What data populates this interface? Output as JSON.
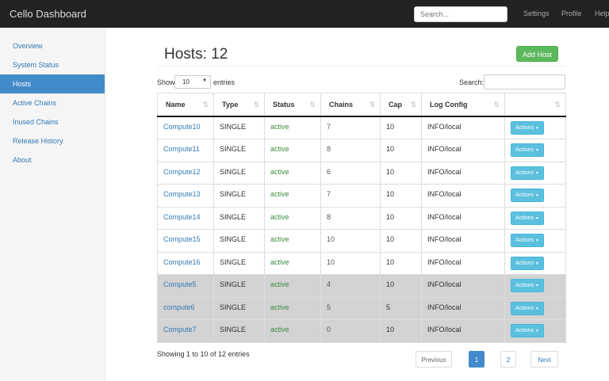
{
  "navbar": {
    "brand": "Cello Dashboard",
    "search_placeholder": "Search...",
    "links": [
      "Settings",
      "Profile",
      "Help"
    ]
  },
  "sidebar": {
    "items": [
      {
        "label": "Overview",
        "active": false
      },
      {
        "label": "System Status",
        "active": false
      },
      {
        "label": "Hosts",
        "active": true
      },
      {
        "label": "Active Chains",
        "active": false
      },
      {
        "label": "Inused Chains",
        "active": false
      },
      {
        "label": "Release History",
        "active": false
      },
      {
        "label": "About",
        "active": false
      }
    ]
  },
  "main": {
    "title": "Hosts: 12",
    "add_button": "Add Host",
    "show_label": "Show",
    "entries_value": "10",
    "entries_label": "entries",
    "search_label": "Search:",
    "columns": [
      "Name",
      "Type",
      "Status",
      "Chains",
      "Cap",
      "Log Config",
      ""
    ],
    "rows": [
      {
        "name": "Compute10",
        "type": "SINGLE",
        "status": "active",
        "chains": "7",
        "cap": "10",
        "log": "INFO/local",
        "action": "Actions",
        "shaded": false
      },
      {
        "name": "Compute11",
        "type": "SINGLE",
        "status": "active",
        "chains": "8",
        "cap": "10",
        "log": "INFO/local",
        "action": "Actions",
        "shaded": false
      },
      {
        "name": "Compute12",
        "type": "SINGLE",
        "status": "active",
        "chains": "6",
        "cap": "10",
        "log": "INFO/local",
        "action": "Actions",
        "shaded": false
      },
      {
        "name": "Compute13",
        "type": "SINGLE",
        "status": "active",
        "chains": "7",
        "cap": "10",
        "log": "INFO/local",
        "action": "Actions",
        "shaded": false
      },
      {
        "name": "Compute14",
        "type": "SINGLE",
        "status": "active",
        "chains": "8",
        "cap": "10",
        "log": "INFO/local",
        "action": "Actions",
        "shaded": false
      },
      {
        "name": "Compute15",
        "type": "SINGLE",
        "status": "active",
        "chains": "10",
        "cap": "10",
        "log": "INFO/local",
        "action": "Actions",
        "shaded": false
      },
      {
        "name": "Compute16",
        "type": "SINGLE",
        "status": "active",
        "chains": "10",
        "cap": "10",
        "log": "INFO/local",
        "action": "Actions",
        "shaded": false
      },
      {
        "name": "Compute5",
        "type": "SINGLE",
        "status": "active",
        "chains": "4",
        "cap": "10",
        "log": "INFO/local",
        "action": "Actions",
        "shaded": true
      },
      {
        "name": "compute6",
        "type": "SINGLE",
        "status": "active",
        "chains": "5",
        "cap": "5",
        "log": "INFO/local",
        "action": "Actions",
        "shaded": true
      },
      {
        "name": "Compute7",
        "type": "SINGLE",
        "status": "active",
        "chains": "0",
        "cap": "10",
        "log": "INFO/local",
        "action": "Actions",
        "shaded": true
      }
    ],
    "info": "Showing 1 to 10 of 12 entries",
    "pagination": {
      "previous": "Previous",
      "pages": [
        "1",
        "2"
      ],
      "current": "1",
      "next": "Next"
    }
  },
  "colors": {
    "navbar_bg": "#222222",
    "primary": "#428bca",
    "success": "#5cb85c",
    "info": "#5bc0de",
    "status_active": "#3c8b3c",
    "row_highlight": "#d3d3d3"
  },
  "icons": {
    "sort": "sort-arrows-icon",
    "dropdown": "caret-down-icon"
  }
}
